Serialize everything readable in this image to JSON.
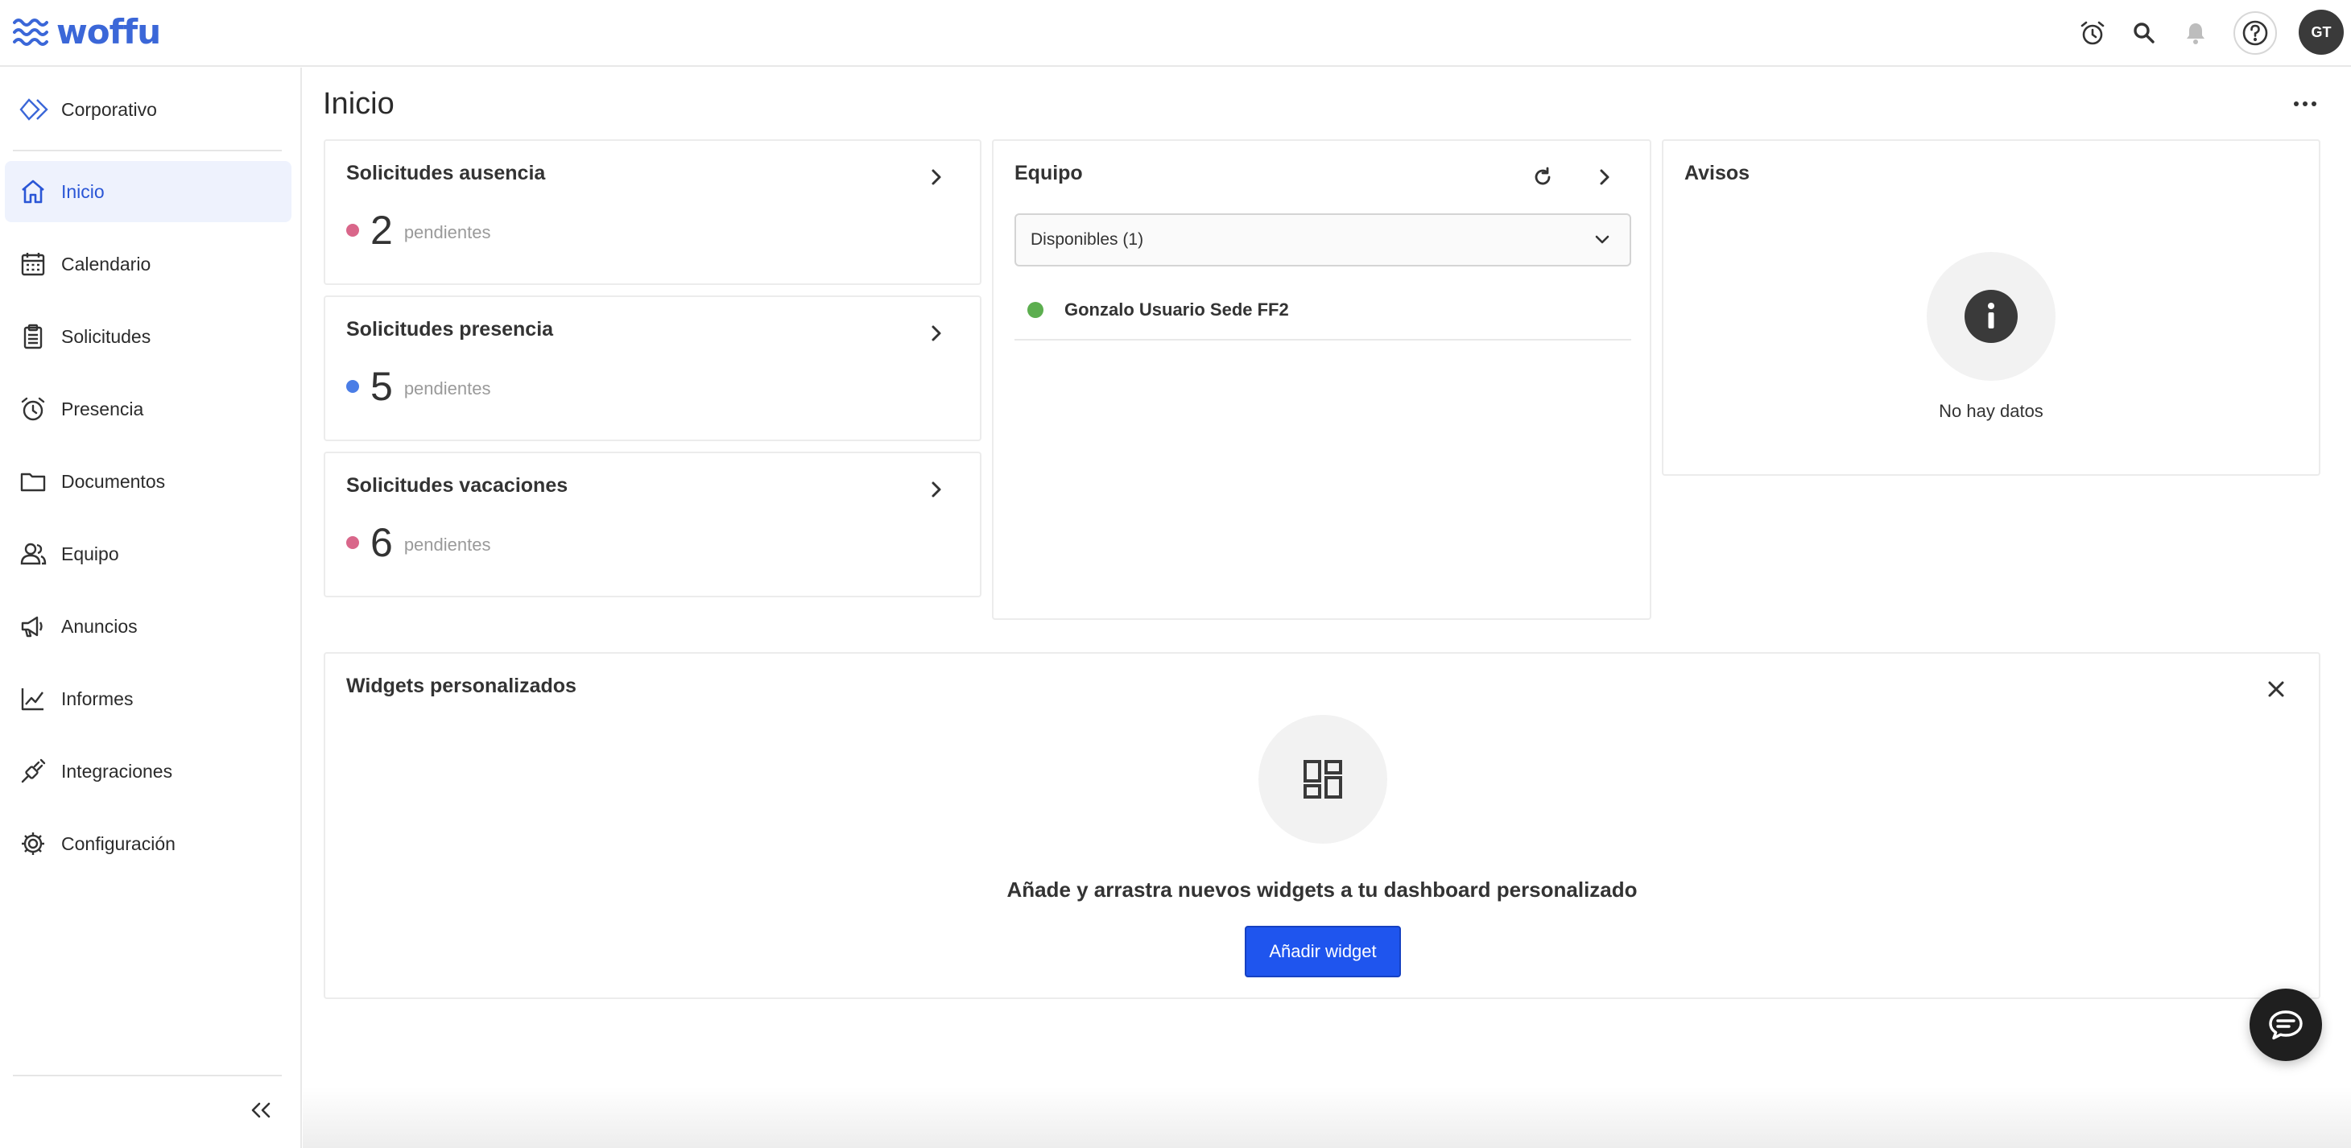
{
  "app": {
    "logo_text": "woffu",
    "brand_color": "#3b67d8",
    "accent_color": "#1f55ee"
  },
  "topbar": {
    "icons": [
      "alarm-clock-icon",
      "search-icon",
      "bell-icon",
      "help-icon"
    ],
    "avatar_initials": "GT"
  },
  "sidebar": {
    "corporate_label": "Corporativo",
    "items": [
      {
        "label": "Inicio",
        "icon": "home-icon",
        "active": true
      },
      {
        "label": "Calendario",
        "icon": "calendar-icon",
        "active": false
      },
      {
        "label": "Solicitudes",
        "icon": "clipboard-icon",
        "active": false
      },
      {
        "label": "Presencia",
        "icon": "alarm-clock-icon",
        "active": false
      },
      {
        "label": "Documentos",
        "icon": "folder-icon",
        "active": false
      },
      {
        "label": "Equipo",
        "icon": "team-icon",
        "active": false
      },
      {
        "label": "Anuncios",
        "icon": "megaphone-icon",
        "active": false
      },
      {
        "label": "Informes",
        "icon": "chart-line-icon",
        "active": false
      },
      {
        "label": "Integraciones",
        "icon": "plug-icon",
        "active": false
      },
      {
        "label": "Configuración",
        "icon": "gear-icon",
        "active": false
      }
    ]
  },
  "main": {
    "title": "Inicio",
    "requests": [
      {
        "title": "Solicitudes ausencia",
        "count": "2",
        "label": "pendientes",
        "dot_color": "#d9668a"
      },
      {
        "title": "Solicitudes presencia",
        "count": "5",
        "label": "pendientes",
        "dot_color": "#4a7de6"
      },
      {
        "title": "Solicitudes vacaciones",
        "count": "6",
        "label": "pendientes",
        "dot_color": "#d9668a"
      }
    ],
    "team": {
      "title": "Equipo",
      "filter_value": "Disponibles (1)",
      "members": [
        {
          "name": "Gonzalo Usuario Sede FF2",
          "status_color": "#5cae4f"
        }
      ]
    },
    "notices": {
      "title": "Avisos",
      "empty_text": "No hay datos"
    },
    "widgets": {
      "title": "Widgets personalizados",
      "message": "Añade y arrastra nuevos widgets a tu dashboard personalizado",
      "button_label": "Añadir widget"
    }
  }
}
